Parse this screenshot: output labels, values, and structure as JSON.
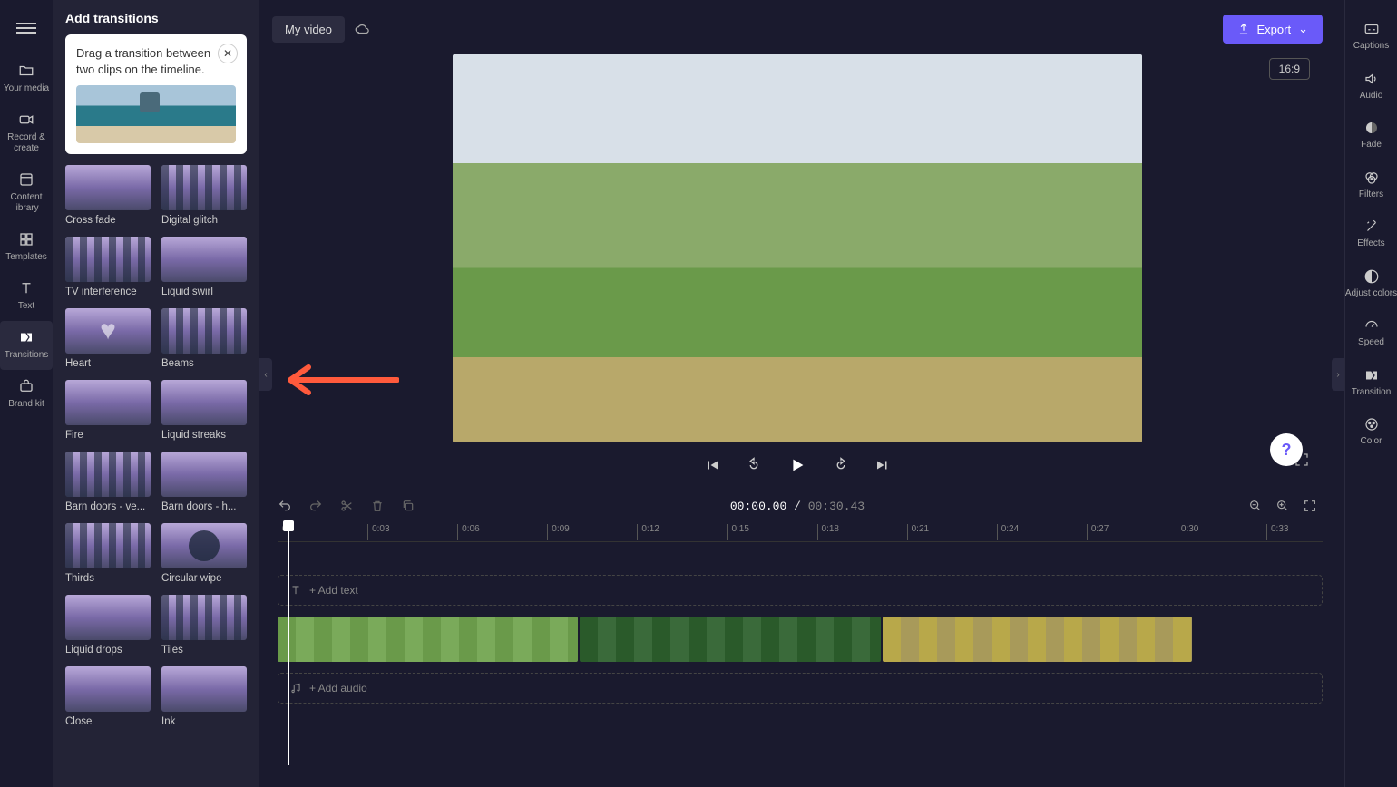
{
  "leftRail": {
    "items": [
      {
        "label": "Your media"
      },
      {
        "label": "Record & create"
      },
      {
        "label": "Content library"
      },
      {
        "label": "Templates"
      },
      {
        "label": "Text"
      },
      {
        "label": "Transitions"
      },
      {
        "label": "Brand kit"
      }
    ]
  },
  "panel": {
    "title": "Add transitions",
    "tip": "Drag a transition between two clips on the timeline.",
    "transitions": [
      {
        "label": "Cross fade"
      },
      {
        "label": "Digital glitch"
      },
      {
        "label": "TV interference"
      },
      {
        "label": "Liquid swirl"
      },
      {
        "label": "Heart"
      },
      {
        "label": "Beams"
      },
      {
        "label": "Fire"
      },
      {
        "label": "Liquid streaks"
      },
      {
        "label": "Barn doors - ve..."
      },
      {
        "label": "Barn doors - h..."
      },
      {
        "label": "Thirds"
      },
      {
        "label": "Circular wipe"
      },
      {
        "label": "Liquid drops"
      },
      {
        "label": "Tiles"
      },
      {
        "label": "Close"
      },
      {
        "label": "Ink"
      }
    ]
  },
  "header": {
    "projectTitle": "My video",
    "exportLabel": "Export",
    "aspectRatio": "16:9"
  },
  "rightRail": {
    "items": [
      {
        "label": "Captions"
      },
      {
        "label": "Audio"
      },
      {
        "label": "Fade"
      },
      {
        "label": "Filters"
      },
      {
        "label": "Effects"
      },
      {
        "label": "Adjust colors"
      },
      {
        "label": "Speed"
      },
      {
        "label": "Transition"
      },
      {
        "label": "Color"
      }
    ]
  },
  "timeline": {
    "currentTime": "00:00.00",
    "duration": "00:30.43",
    "ticks": [
      "0",
      "0:03",
      "0:06",
      "0:09",
      "0:12",
      "0:15",
      "0:18",
      "0:21",
      "0:24",
      "0:27",
      "0:30",
      "0:33"
    ],
    "addText": "+ Add text",
    "addAudio": "+ Add audio"
  }
}
